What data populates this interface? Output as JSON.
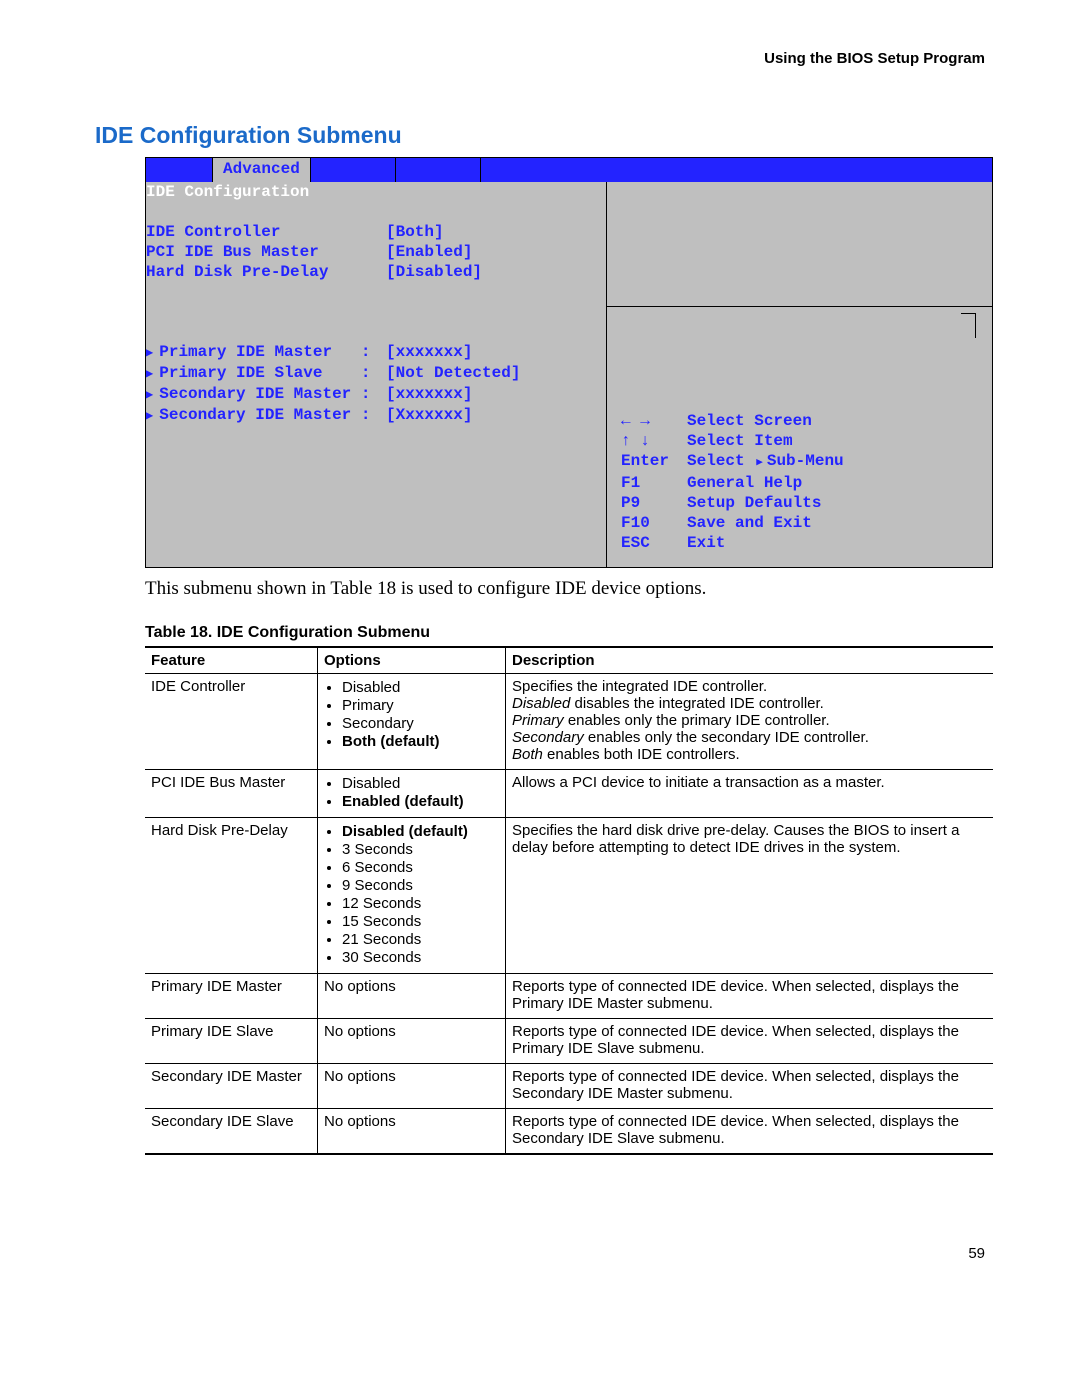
{
  "doc_header": "Using the BIOS Setup Program",
  "section_title": "IDE Configuration Submenu",
  "bios": {
    "active_tab": "Advanced",
    "panel_title": "IDE Configuration",
    "settings": [
      {
        "label": "IDE Controller",
        "value": "[Both]"
      },
      {
        "label": "PCI IDE Bus Master",
        "value": "[Enabled]"
      },
      {
        "label": "Hard Disk Pre-Delay",
        "value": "[Disabled]"
      }
    ],
    "drives": [
      {
        "label": "Primary IDE Master   :",
        "value": "[xxxxxxx]"
      },
      {
        "label": "Primary IDE Slave    :",
        "value": "[Not Detected]"
      },
      {
        "label": "Secondary IDE Master :",
        "value": "[xxxxxxx]"
      },
      {
        "label": "Secondary IDE Master :",
        "value": "[Xxxxxxx]"
      }
    ],
    "help": [
      {
        "key": "← →",
        "action": "Select Screen"
      },
      {
        "key": "↑ ↓",
        "action": "Select Item"
      },
      {
        "key": "Enter",
        "action_prefix": "Select ",
        "action_suffix": "Sub-Menu",
        "submenu": true
      },
      {
        "key": "F1",
        "action": "General Help"
      },
      {
        "key": "P9",
        "action": "Setup Defaults"
      },
      {
        "key": "F10",
        "action": "Save and Exit"
      },
      {
        "key": "ESC",
        "action": "Exit"
      }
    ]
  },
  "caption": "This submenu shown in Table 18 is used to configure IDE device options.",
  "table_title": "Table 18.   IDE Configuration Submenu",
  "columns": {
    "feature": "Feature",
    "options": "Options",
    "description": "Description"
  },
  "rows": [
    {
      "feature": "IDE Controller",
      "options": [
        {
          "text": "Disabled"
        },
        {
          "text": "Primary"
        },
        {
          "text": "Secondary"
        },
        {
          "text": "Both (default)",
          "bold": true
        }
      ],
      "description_lines": [
        {
          "text": "Specifies the integrated IDE controller."
        },
        {
          "ital_prefix": "Disabled",
          "text": " disables the integrated IDE controller."
        },
        {
          "ital_prefix": "Primary",
          "text": " enables only the primary IDE controller."
        },
        {
          "ital_prefix": "Secondary",
          "text": " enables only the secondary IDE controller."
        },
        {
          "ital_prefix": "Both",
          "text": " enables both IDE controllers."
        }
      ]
    },
    {
      "feature": "PCI IDE Bus Master",
      "options": [
        {
          "text": "Disabled"
        },
        {
          "text": "Enabled (default)",
          "bold": true
        }
      ],
      "description_lines": [
        {
          "text": "Allows a PCI device to initiate a transaction as a master."
        }
      ]
    },
    {
      "feature": "Hard Disk Pre-Delay",
      "options": [
        {
          "text": "Disabled (default)",
          "bold": true
        },
        {
          "text": "3 Seconds"
        },
        {
          "text": "6 Seconds"
        },
        {
          "text": "9 Seconds"
        },
        {
          "text": "12 Seconds"
        },
        {
          "text": "15 Seconds"
        },
        {
          "text": "21 Seconds"
        },
        {
          "text": "30 Seconds"
        }
      ],
      "description_lines": [
        {
          "text": "Specifies the hard disk drive pre-delay.  Causes the BIOS to insert a delay before attempting to detect IDE drives in the system."
        }
      ]
    },
    {
      "feature": "Primary IDE Master",
      "options_text": "No options",
      "description_lines": [
        {
          "text": "Reports type of connected IDE device.  When selected, displays the Primary IDE Master submenu."
        }
      ]
    },
    {
      "feature": "Primary IDE Slave",
      "options_text": "No options",
      "description_lines": [
        {
          "text": "Reports type of connected IDE device.  When selected, displays the Primary IDE Slave submenu."
        }
      ]
    },
    {
      "feature": "Secondary IDE Master",
      "options_text": "No options",
      "description_lines": [
        {
          "text": "Reports type of connected IDE device.  When selected, displays the Secondary IDE Master submenu."
        }
      ]
    },
    {
      "feature": "Secondary IDE Slave",
      "options_text": "No options",
      "description_lines": [
        {
          "text": "Reports type of connected IDE device.  When selected, displays the Secondary IDE Slave submenu."
        }
      ],
      "last": true
    }
  ],
  "page_number": "59"
}
